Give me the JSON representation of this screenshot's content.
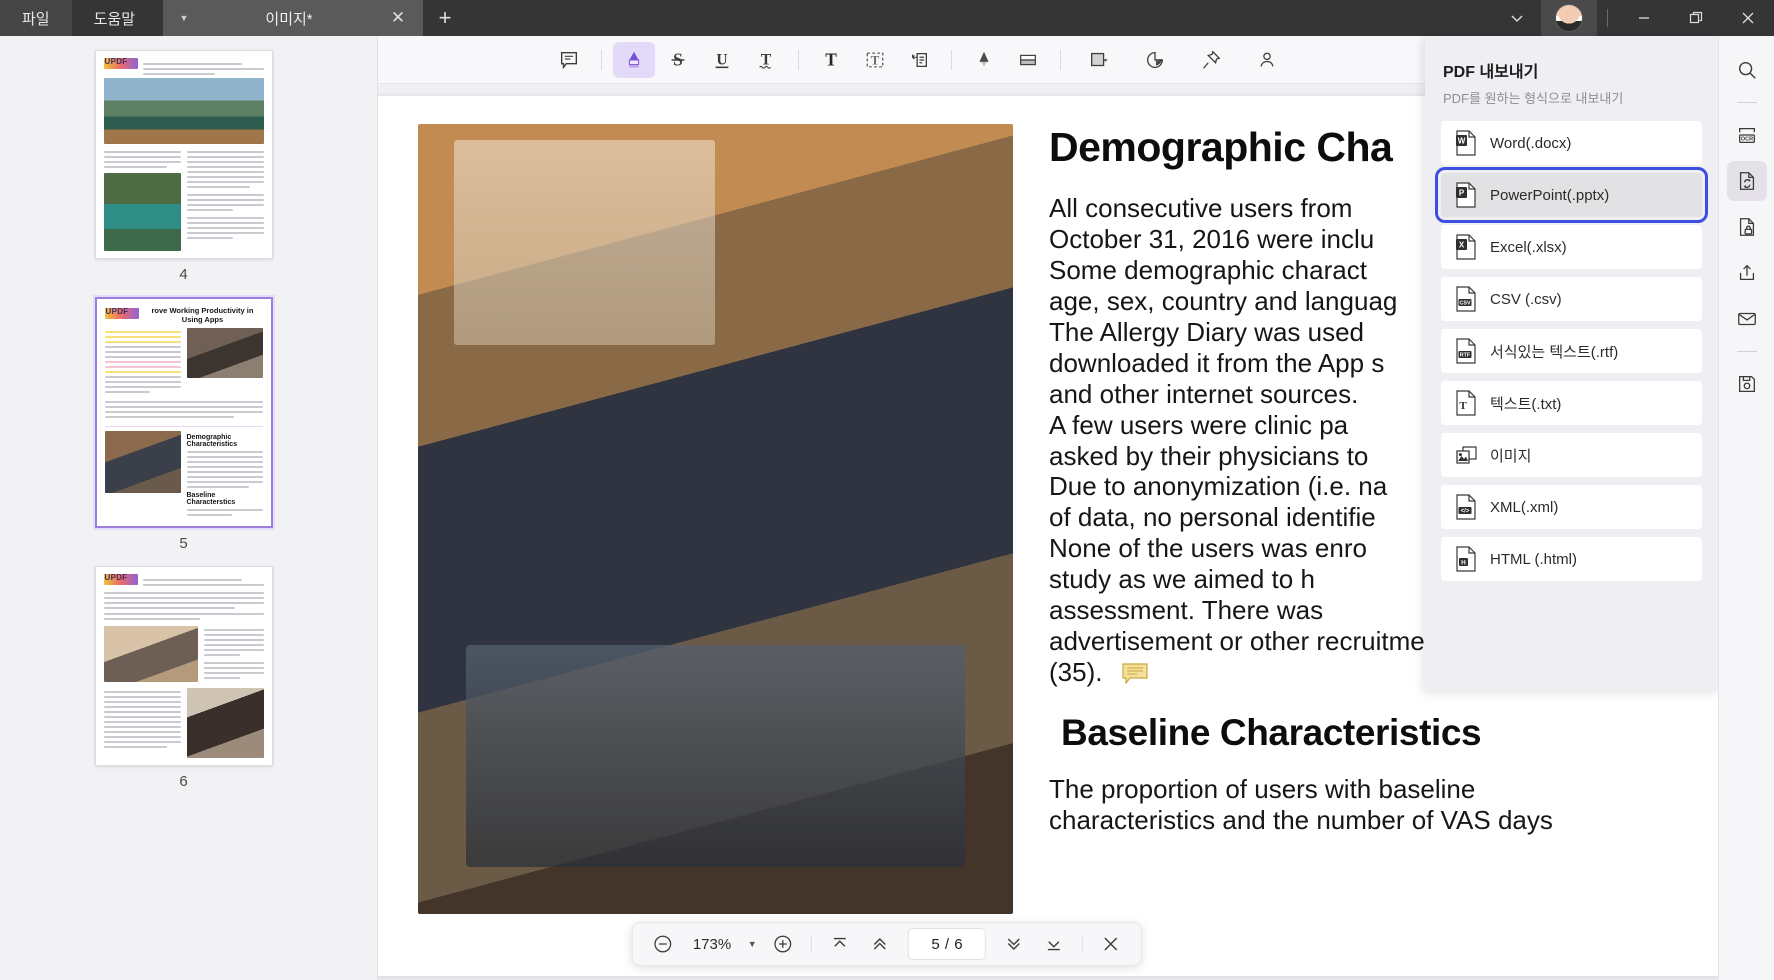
{
  "titlebar": {
    "menus": [
      {
        "label": "파일",
        "name": "menu-file"
      },
      {
        "label": "도움말",
        "name": "menu-help"
      }
    ],
    "tab": {
      "title": "이미지*",
      "caret": "chevron-down-icon",
      "close": "✕"
    },
    "new_tab": "+",
    "window": {
      "minimize": "—",
      "maximize": "❐",
      "close": "✕"
    }
  },
  "thumbnails": {
    "pages": [
      {
        "number": "4",
        "selected": false
      },
      {
        "number": "5",
        "selected": true
      },
      {
        "number": "6",
        "selected": false
      }
    ],
    "page5_headline": "rove Working Productivity in Using Apps",
    "page5_section": "Demographic Characteristics",
    "page5_section2": "Baseline Characterstics",
    "logo_text": "UPDF"
  },
  "toolbar": {
    "items": [
      {
        "name": "comment-icon",
        "label": "Comment",
        "active": false
      },
      {
        "name": "highlighter-icon",
        "label": "Highlight",
        "active": true
      },
      {
        "name": "strikethrough-icon",
        "label": "Strikethrough",
        "active": false
      },
      {
        "name": "underline-icon",
        "label": "Underline",
        "active": false
      },
      {
        "name": "squiggly-underline-icon",
        "label": "Squiggly",
        "active": false
      },
      {
        "name": "text-box-icon",
        "label": "Text",
        "active": false
      },
      {
        "name": "text-callout-icon",
        "label": "Text Callout",
        "active": false
      },
      {
        "name": "sticky-note-icon",
        "label": "Note",
        "active": false
      },
      {
        "name": "pencil-icon",
        "label": "Pencil",
        "active": false
      },
      {
        "name": "eraser-icon",
        "label": "Eraser",
        "active": false
      },
      {
        "name": "shape-icon",
        "label": "Shapes",
        "active": false
      },
      {
        "name": "stamp-icon",
        "label": "Stamp",
        "active": false
      },
      {
        "name": "pin-icon",
        "label": "Pin",
        "active": false
      },
      {
        "name": "signature-icon",
        "label": "Signature",
        "active": false
      }
    ]
  },
  "document": {
    "heading1": "Demographic Cha",
    "paragraph1_lines": [
      "All  consecutive  users  from",
      "October  31,  2016  were  inclu",
      "Some  demographic  charact",
      "age, sex, country and languag",
      "The  Allergy  Diary  was  used",
      "downloaded it from the App s",
      "and other internet sources."
    ],
    "paragraph2_lines": [
      "A  few  users  were  clinic  pa",
      "asked  by  their  physicians  to",
      "Due to anonymization (i.e. na",
      "of data, no personal identifie",
      "None  of  the  users  was  enro",
      "study   as   we   aimed   to   h",
      "assessment.      There      was",
      "advertisement  or  other  recruitment  campaign",
      "(35)."
    ],
    "heading2": "Baseline Characteristics",
    "paragraph3_lines": [
      "The      proportion      of      users      with      baseline",
      "characteristics and the number of VAS days"
    ]
  },
  "export_panel": {
    "title": "PDF 내보내기",
    "subtitle": "PDF를 원하는 형식으로 내보내기",
    "items": [
      {
        "label": "Word(.docx)",
        "icon": "word-file-icon",
        "badge": "W",
        "color": "#2B579A",
        "selected": false
      },
      {
        "label": "PowerPoint(.pptx)",
        "icon": "powerpoint-file-icon",
        "badge": "P",
        "color": "#D04423",
        "selected": true
      },
      {
        "label": "Excel(.xlsx)",
        "icon": "excel-file-icon",
        "badge": "X",
        "color": "#217346",
        "selected": false
      },
      {
        "label": "CSV (.csv)",
        "icon": "csv-file-icon",
        "badge": "CSV",
        "color": "#4a4a4a",
        "selected": false
      },
      {
        "label": "서식있는 텍스트(.rtf)",
        "icon": "rtf-file-icon",
        "badge": "RTF",
        "color": "#4a4a4a",
        "selected": false
      },
      {
        "label": "텍스트(.txt)",
        "icon": "txt-file-icon",
        "badge": "T",
        "color": "#4a4a4a",
        "selected": false
      },
      {
        "label": "이미지",
        "icon": "image-file-icon",
        "badge": "",
        "color": "#4a4a4a",
        "selected": false
      },
      {
        "label": "XML(.xml)",
        "icon": "xml-file-icon",
        "badge": "</>",
        "color": "#4a4a4a",
        "selected": false
      },
      {
        "label": "HTML (.html)",
        "icon": "html-file-icon",
        "badge": "H",
        "color": "#4a4a4a",
        "selected": false
      }
    ],
    "selection_color": "#3c4fe0"
  },
  "rail": {
    "items": [
      {
        "name": "search-icon",
        "label": "검색",
        "active": false
      },
      {
        "name": "ocr-icon",
        "label": "OCR",
        "active": false
      },
      {
        "name": "convert-icon",
        "label": "변환",
        "active": true
      },
      {
        "name": "protect-icon",
        "label": "보호",
        "active": false
      },
      {
        "name": "share-icon",
        "label": "공유",
        "active": false
      },
      {
        "name": "email-icon",
        "label": "이메일",
        "active": false
      },
      {
        "name": "save-icon",
        "label": "저장",
        "active": false
      }
    ]
  },
  "bottombar": {
    "zoom_out": "zoom-out-icon",
    "zoom_value": "173%",
    "zoom_caret": "chevron-down-icon",
    "zoom_in": "zoom-in-icon",
    "first_page": "first-page-icon",
    "prev_page": "prev-page-icon",
    "page_indicator": "5 / 6",
    "next_page": "next-page-icon",
    "last_page": "last-page-icon",
    "close": "close-icon"
  }
}
